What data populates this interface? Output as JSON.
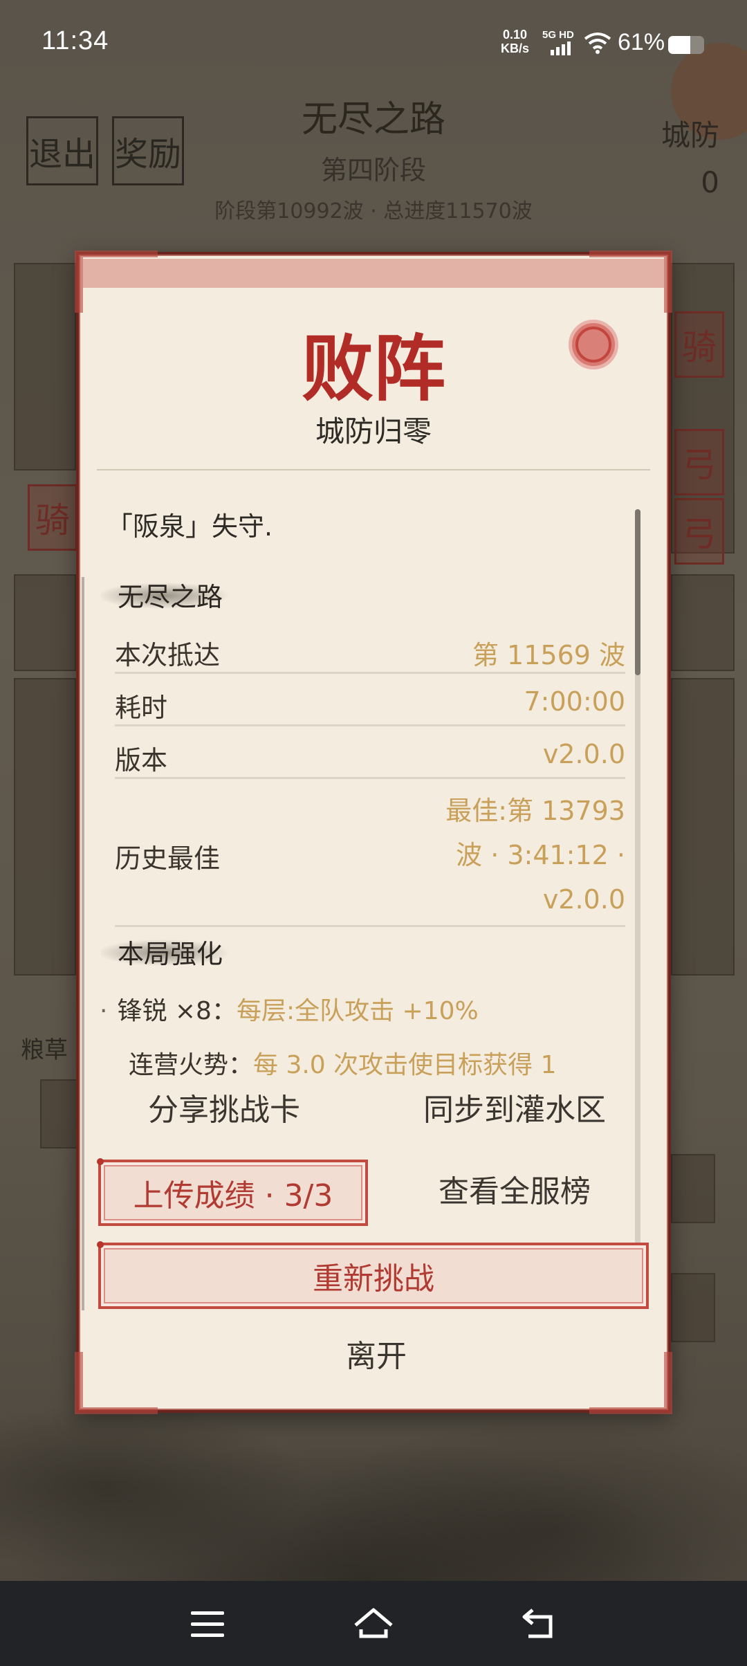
{
  "status_bar": {
    "time": "11:34",
    "net_speed_value": "0.10",
    "net_speed_unit": "KB/s",
    "network_type": "5G HD",
    "battery_percent": "61%",
    "battery_level": 0.61
  },
  "background": {
    "mode_title": "无尽之路",
    "stage": "第四阶段",
    "progress": "阶段第10992波 · 总进度11570波",
    "exit_label": "退出",
    "reward_label": "奖励",
    "city_defense_label": "城防",
    "city_defense_value": "0",
    "grain_label": "粮草"
  },
  "dialog": {
    "title": "败阵",
    "subtitle": "城防归零",
    "lost_message": "「阪泉」失守.",
    "section_endless": "无尽之路",
    "stats": [
      {
        "key": "本次抵达",
        "value": "第 11569 波"
      },
      {
        "key": "耗时",
        "value": "7:00:00"
      },
      {
        "key": "版本",
        "value": "v2.0.0"
      },
      {
        "key": "历史最佳",
        "value_lines": [
          "最佳:第 13793",
          "波 · 3:41:12 ·",
          "v2.0.0"
        ]
      }
    ],
    "section_buffs": "本局强化",
    "buffs": [
      {
        "name": "锋锐 ×8：",
        "desc": "每层:全队攻击 +10%"
      },
      {
        "name": "连营火势：",
        "desc": "每 3.0 次攻击使目标获得 1"
      }
    ],
    "share_label": "分享挑战卡",
    "sync_label": "同步到灌水区",
    "upload_label": "上传成绩 · 3/3",
    "leaderboard_label": "查看全服榜",
    "retry_label": "重新挑战",
    "leave_label": "离开"
  },
  "colors": {
    "title_red": "#b12c26",
    "gold_text": "#c9a05a",
    "dialog_bg": "#f3ecdf",
    "border_dark_red": "#6a231d"
  }
}
